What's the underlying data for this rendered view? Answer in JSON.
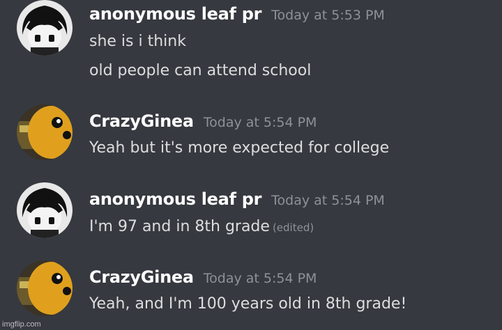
{
  "messages": [
    {
      "username": "anonymous leaf pr",
      "timestamp": "Today at 5:53 PM",
      "avatar_icon": "omori-avatar-icon",
      "lines": [
        {
          "text": "she is i think",
          "edited": ""
        },
        {
          "text": "old people can attend school",
          "edited": ""
        }
      ]
    },
    {
      "username": "CrazyGinea",
      "timestamp": "Today at 5:54 PM",
      "avatar_icon": "orange-character-avatar-icon",
      "lines": [
        {
          "text": "Yeah but it's more expected for college",
          "edited": ""
        }
      ]
    },
    {
      "username": "anonymous leaf pr",
      "timestamp": "Today at 5:54 PM",
      "avatar_icon": "omori-avatar-icon",
      "lines": [
        {
          "text": "I'm 97 and in 8th grade",
          "edited": "(edited)"
        }
      ]
    },
    {
      "username": "CrazyGinea",
      "timestamp": "Today at 5:54 PM",
      "avatar_icon": "orange-character-avatar-icon",
      "lines": [
        {
          "text": "Yeah, and I'm 100 years old in 8th grade!",
          "edited": ""
        }
      ]
    }
  ],
  "watermark": "imgflip.com",
  "colors": {
    "background": "#36393f",
    "username": "#ffffff",
    "message_text": "#dcddde",
    "timestamp": "#8e9297"
  }
}
